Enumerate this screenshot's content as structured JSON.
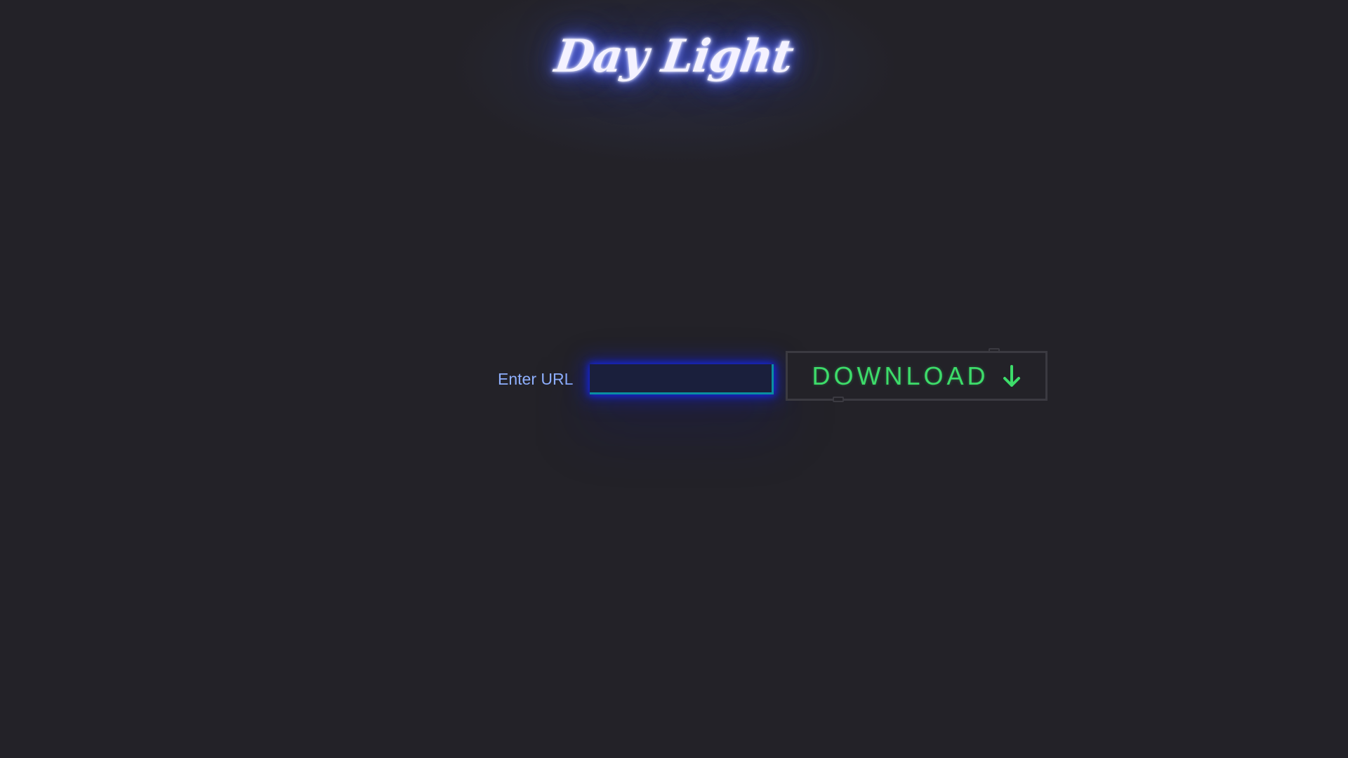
{
  "header": {
    "logo_text": "Day Light"
  },
  "form": {
    "url_label": "Enter URL",
    "url_value": "",
    "url_placeholder": ""
  },
  "download_button": {
    "label": "DOWNLOAD",
    "icon": "arrow-down-icon"
  },
  "colors": {
    "background": "#232228",
    "logo_glow": "#5a6dff",
    "label_text": "#8fb0ff",
    "input_glow": "#1428ff",
    "download_text": "#3ddc6a"
  }
}
